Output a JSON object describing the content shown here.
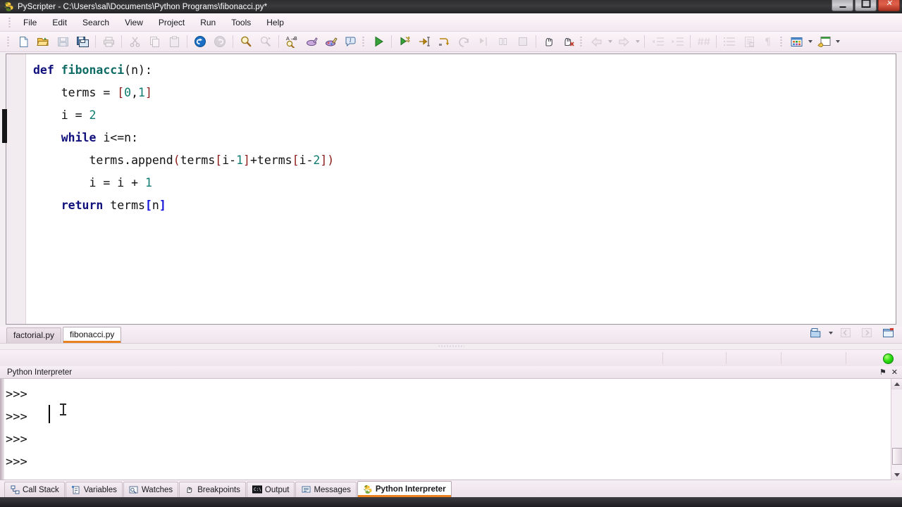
{
  "window": {
    "title": "PyScripter - C:\\Users\\sal\\Documents\\Python Programs\\fibonacci.py*",
    "app_icon": "pyscripter-icon",
    "controls": {
      "minimize": "–",
      "maximize": "❐",
      "close": "✕"
    }
  },
  "menu": {
    "items": [
      {
        "label": "File"
      },
      {
        "label": "Edit"
      },
      {
        "label": "Search"
      },
      {
        "label": "View"
      },
      {
        "label": "Project"
      },
      {
        "label": "Run"
      },
      {
        "label": "Tools"
      },
      {
        "label": "Help"
      }
    ]
  },
  "toolbar": {
    "groups": [
      [
        "new-file-icon",
        "open-file-icon",
        "save-file-icon",
        "save-all-icon"
      ],
      [
        "print-icon"
      ],
      [
        "cut-icon",
        "copy-icon",
        "paste-icon"
      ],
      [
        "undo-icon",
        "redo-icon"
      ],
      [
        "find-icon",
        "find-next-icon"
      ],
      [
        "find-replace-icon",
        "highlight-icon",
        "syntax-check-icon",
        "code-explorer-icon"
      ],
      [
        "run-icon"
      ],
      [
        "debug-icon",
        "step-into-icon",
        "step-over-icon",
        "step-out-icon",
        "run-to-cursor-icon",
        "pause-icon",
        "stop-icon"
      ],
      [
        "toggle-breakpoint-icon",
        "clear-breakpoints-icon"
      ],
      [
        "navigate-back-icon",
        "navigate-forward-icon"
      ],
      [
        "unindent-icon",
        "indent-icon"
      ],
      [
        "comment-icon"
      ],
      [
        "todo-list-icon",
        "code-template-icon",
        "show-whitespace-icon"
      ],
      [
        "layout-icon",
        "options-icon"
      ]
    ]
  },
  "editor": {
    "language": "python",
    "lines": [
      [
        {
          "t": "def ",
          "c": "k"
        },
        {
          "t": "fibonacci",
          "c": "fn"
        },
        {
          "t": "(n):",
          "c": "pl"
        }
      ],
      [
        {
          "t": "    terms = ",
          "c": "pl"
        },
        {
          "t": "[",
          "c": "br"
        },
        {
          "t": "0",
          "c": "num"
        },
        {
          "t": ",",
          "c": "pl"
        },
        {
          "t": "1",
          "c": "num"
        },
        {
          "t": "]",
          "c": "br"
        }
      ],
      [
        {
          "t": "    i = ",
          "c": "pl"
        },
        {
          "t": "2",
          "c": "num"
        }
      ],
      [
        {
          "t": "    while",
          "c": "k"
        },
        {
          "t": " i<=n:",
          "c": "pl"
        }
      ],
      [
        {
          "t": "        terms.append",
          "c": "pl"
        },
        {
          "t": "(",
          "c": "br"
        },
        {
          "t": "terms",
          "c": "pl"
        },
        {
          "t": "[",
          "c": "br"
        },
        {
          "t": "i-",
          "c": "pl"
        },
        {
          "t": "1",
          "c": "num"
        },
        {
          "t": "]",
          "c": "br"
        },
        {
          "t": "+terms",
          "c": "pl"
        },
        {
          "t": "[",
          "c": "br"
        },
        {
          "t": "i-",
          "c": "pl"
        },
        {
          "t": "2",
          "c": "num"
        },
        {
          "t": "]",
          "c": "br"
        },
        {
          "t": ")",
          "c": "br"
        }
      ],
      [
        {
          "t": "        i = i + ",
          "c": "pl"
        },
        {
          "t": "1",
          "c": "num"
        }
      ],
      [
        {
          "t": "    return",
          "c": "k"
        },
        {
          "t": " terms",
          "c": "pl"
        },
        {
          "t": "[",
          "c": "brhl"
        },
        {
          "t": "n",
          "c": "pl"
        },
        {
          "t": "]",
          "c": "brhl"
        }
      ]
    ],
    "plain_text": "def fibonacci(n):\n    terms = [0,1]\n    i = 2\n    while i<=n:\n        terms.append(terms[i-1]+terms[i-2])\n        i = i + 1\n    return terms[n]"
  },
  "file_tabs": {
    "items": [
      {
        "label": "factorial.py",
        "active": false
      },
      {
        "label": "fibonacci.py",
        "active": true
      }
    ],
    "right_icons": [
      "open-folder-dropdown-icon",
      "previous-tab-icon",
      "next-tab-icon",
      "close-tab-icon"
    ]
  },
  "statusbar": {
    "cells": [
      "",
      "",
      "",
      "",
      ""
    ],
    "indicator": "running-led",
    "indicator_color": "#2ee013"
  },
  "interpreter_panel": {
    "title": "Python Interpreter",
    "pin_icon": "⚑",
    "close_icon": "✕",
    "lines": [
      ">>> ",
      ">>> ",
      ">>> ",
      ">>> "
    ],
    "cursor_visible": true
  },
  "bottom_tabs": {
    "items": [
      {
        "label": "Call Stack",
        "icon": "call-stack-icon",
        "active": false
      },
      {
        "label": "Variables",
        "icon": "variables-icon",
        "active": false
      },
      {
        "label": "Watches",
        "icon": "watches-icon",
        "active": false
      },
      {
        "label": "Breakpoints",
        "icon": "breakpoints-icon",
        "active": false
      },
      {
        "label": "Output",
        "icon": "output-icon",
        "active": false
      },
      {
        "label": "Messages",
        "icon": "messages-icon",
        "active": false
      },
      {
        "label": "Python Interpreter",
        "icon": "python-icon",
        "active": true
      }
    ]
  },
  "colors": {
    "accent": "#e8821e",
    "keyword": "#10107c",
    "function": "#0e6b63",
    "number": "#0e7b70",
    "bracket": "#8b1a1a",
    "bracket_highlight": "#1414d8",
    "chrome": "#f3eef2"
  }
}
